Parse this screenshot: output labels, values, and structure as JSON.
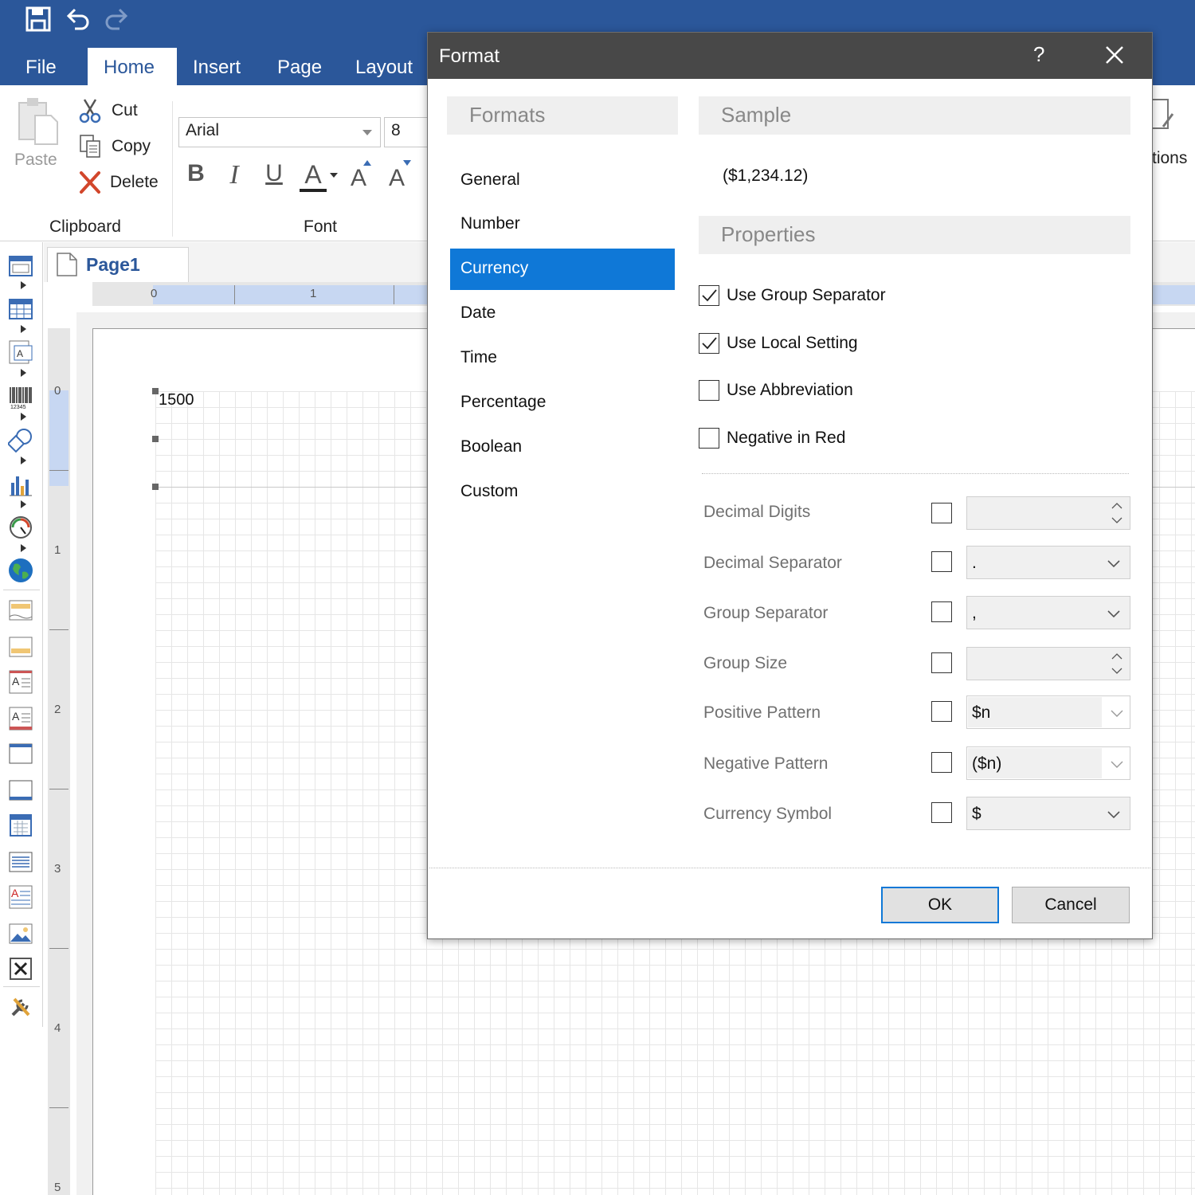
{
  "ribbon": {
    "tabs": [
      "File",
      "Home",
      "Insert",
      "Page",
      "Layout"
    ],
    "active_tab": "Home",
    "clipboard": {
      "paste_label": "Paste",
      "cut_label": "Cut",
      "copy_label": "Copy",
      "delete_label": "Delete",
      "group_label": "Clipboard"
    },
    "font": {
      "family": "Arial",
      "size": "8",
      "group_label": "Font",
      "bold_glyph": "B",
      "italic_glyph": "I",
      "underline_glyph": "U",
      "color_glyph": "A",
      "grow_glyph": "A",
      "shrink_glyph": "A"
    },
    "partial_right_label": "tions"
  },
  "document": {
    "tab_label": "Page1",
    "hruler_numbers": [
      "0",
      "1"
    ],
    "vruler_numbers": [
      "0",
      "1",
      "2",
      "3",
      "4",
      "5"
    ],
    "cell_value": "1500"
  },
  "dialog": {
    "title": "Format",
    "help_glyph": "?",
    "formats_header": "Formats",
    "formats": [
      "General",
      "Number",
      "Currency",
      "Date",
      "Time",
      "Percentage",
      "Boolean",
      "Custom"
    ],
    "selected_format": "Currency",
    "sample_header": "Sample",
    "sample_value": "($1,234.12)",
    "properties_header": "Properties",
    "options": [
      {
        "label": "Use Group Separator",
        "checked": true
      },
      {
        "label": "Use Local Setting",
        "checked": true
      },
      {
        "label": "Use Abbreviation",
        "checked": false
      },
      {
        "label": "Negative in Red",
        "checked": false
      }
    ],
    "properties": [
      {
        "label": "Decimal Digits",
        "value": "",
        "control": "spinner"
      },
      {
        "label": "Decimal Separator",
        "value": ".",
        "control": "dropdown"
      },
      {
        "label": "Group Separator",
        "value": ",",
        "control": "dropdown"
      },
      {
        "label": "Group Size",
        "value": "",
        "control": "spinner"
      },
      {
        "label": "Positive Pattern",
        "value": "$n",
        "control": "combo"
      },
      {
        "label": "Negative Pattern",
        "value": "($n)",
        "control": "combo"
      },
      {
        "label": "Currency Symbol",
        "value": "$",
        "control": "dropdown"
      }
    ],
    "ok_label": "OK",
    "cancel_label": "Cancel"
  },
  "colors": {
    "accent": "#2b579a",
    "selection": "#0f78d7",
    "dialog_header": "#484848"
  }
}
